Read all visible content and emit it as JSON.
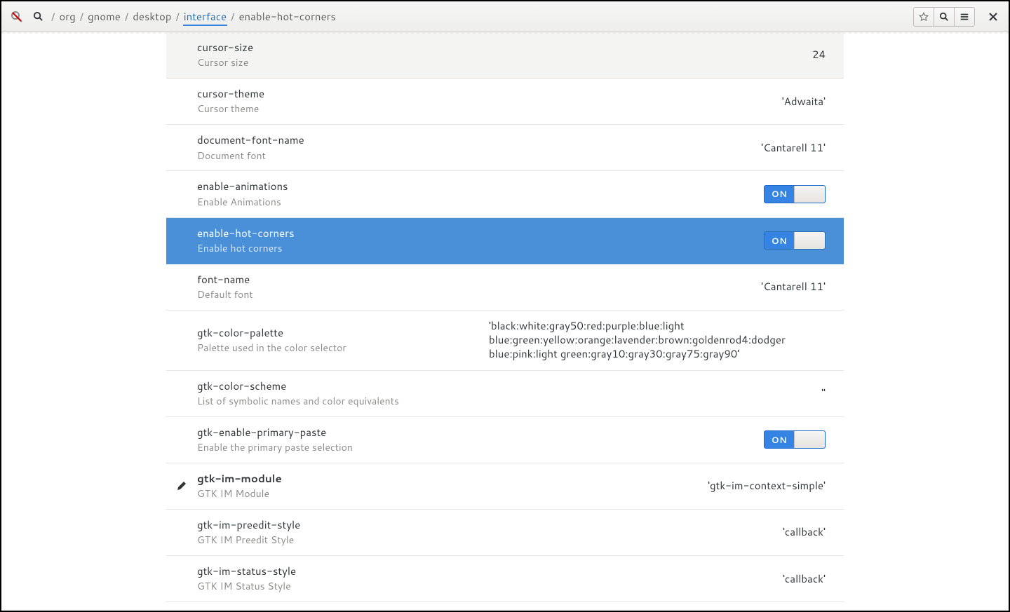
{
  "breadcrumb": {
    "parts": [
      "org",
      "gnome",
      "desktop",
      "interface",
      "enable-hot-corners"
    ],
    "active_index": 3
  },
  "toolbar": {
    "switch_on_label": "ON"
  },
  "rows": [
    {
      "key": "cursor-size",
      "summary": "Cursor size",
      "value": "24",
      "type": "text"
    },
    {
      "key": "cursor-theme",
      "summary": "Cursor theme",
      "value": "'Adwaita'",
      "type": "text"
    },
    {
      "key": "document-font-name",
      "summary": "Document font",
      "value": "'Cantarell 11'",
      "type": "text"
    },
    {
      "key": "enable-animations",
      "summary": "Enable Animations",
      "value": "ON",
      "type": "switch"
    },
    {
      "key": "enable-hot-corners",
      "summary": "Enable hot corners",
      "value": "ON",
      "type": "switch",
      "selected": true
    },
    {
      "key": "font-name",
      "summary": "Default font",
      "value": "'Cantarell 11'",
      "type": "text"
    },
    {
      "key": "gtk-color-palette",
      "summary": "Palette used in the color selector",
      "value": "'black:white:gray50:red:purple:blue:light blue:green:yellow:orange:lavender:brown:goldenrod4:dodger blue:pink:light green:gray10:gray30:gray75:gray90'",
      "type": "text",
      "wide": true
    },
    {
      "key": "gtk-color-scheme",
      "summary": "List of symbolic names and color equivalents",
      "value": "''",
      "type": "text"
    },
    {
      "key": "gtk-enable-primary-paste",
      "summary": "Enable the primary paste selection",
      "value": "ON",
      "type": "switch"
    },
    {
      "key": "gtk-im-module",
      "summary": "GTK IM Module",
      "value": "'gtk-im-context-simple'",
      "type": "text",
      "modified": true
    },
    {
      "key": "gtk-im-preedit-style",
      "summary": "GTK IM Preedit Style",
      "value": "'callback'",
      "type": "text"
    },
    {
      "key": "gtk-im-status-style",
      "summary": "GTK IM Status Style",
      "value": "'callback'",
      "type": "text"
    }
  ]
}
